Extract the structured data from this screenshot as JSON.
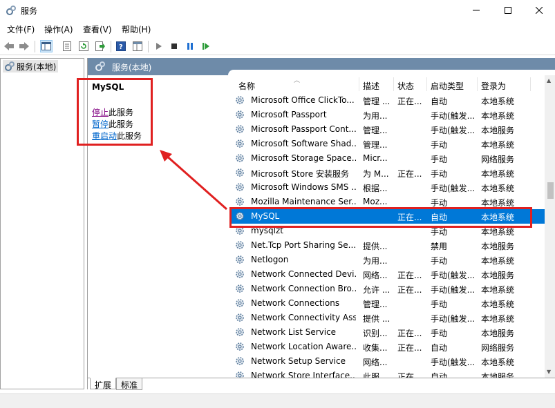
{
  "window": {
    "title": "服务"
  },
  "menu": [
    "文件(F)",
    "操作(A)",
    "查看(V)",
    "帮助(H)"
  ],
  "tree": {
    "item": "服务(本地)"
  },
  "panel": {
    "header": "服务(本地)"
  },
  "extended": {
    "service_name": "MySQL",
    "actions": [
      {
        "link": "停止",
        "rest": "此服务"
      },
      {
        "link": "暂停",
        "rest": "此服务"
      },
      {
        "link": "重启动",
        "rest": "此服务"
      }
    ]
  },
  "columns": [
    "名称",
    "描述",
    "状态",
    "启动类型",
    "登录为"
  ],
  "rows": [
    {
      "name": "Microsoft Office ClickTo...",
      "desc": "管理 ...",
      "status": "正在...",
      "startup": "自动",
      "logon": "本地系统"
    },
    {
      "name": "Microsoft Passport",
      "desc": "为用...",
      "status": "",
      "startup": "手动(触发...",
      "logon": "本地系统"
    },
    {
      "name": "Microsoft Passport Cont...",
      "desc": "管理...",
      "status": "",
      "startup": "手动(触发...",
      "logon": "本地服务"
    },
    {
      "name": "Microsoft Software Shad...",
      "desc": "管理...",
      "status": "",
      "startup": "手动",
      "logon": "本地系统"
    },
    {
      "name": "Microsoft Storage Space...",
      "desc": "Micr...",
      "status": "",
      "startup": "手动",
      "logon": "网络服务"
    },
    {
      "name": "Microsoft Store 安装服务",
      "desc": "为 M...",
      "status": "正在...",
      "startup": "手动",
      "logon": "本地系统"
    },
    {
      "name": "Microsoft Windows SMS ...",
      "desc": "根据...",
      "status": "",
      "startup": "手动(触发...",
      "logon": "本地系统"
    },
    {
      "name": "Mozilla Maintenance Ser...",
      "desc": "Moz...",
      "status": "",
      "startup": "手动",
      "logon": "本地系统"
    },
    {
      "name": "MySQL",
      "desc": "",
      "status": "正在...",
      "startup": "自动",
      "logon": "本地系统",
      "selected": true
    },
    {
      "name": "mysqlzt",
      "desc": "",
      "status": "",
      "startup": "手动",
      "logon": "本地系统"
    },
    {
      "name": "Net.Tcp Port Sharing Se...",
      "desc": "提供...",
      "status": "",
      "startup": "禁用",
      "logon": "本地服务"
    },
    {
      "name": "Netlogon",
      "desc": "为用...",
      "status": "",
      "startup": "手动",
      "logon": "本地系统"
    },
    {
      "name": "Network Connected Devi...",
      "desc": "网络...",
      "status": "正在...",
      "startup": "手动(触发...",
      "logon": "本地服务"
    },
    {
      "name": "Network Connection Bro...",
      "desc": "允许 ...",
      "status": "正在...",
      "startup": "手动(触发...",
      "logon": "本地系统"
    },
    {
      "name": "Network Connections",
      "desc": "管理...",
      "status": "",
      "startup": "手动",
      "logon": "本地系统"
    },
    {
      "name": "Network Connectivity Ass...",
      "desc": "提供 ...",
      "status": "",
      "startup": "手动(触发...",
      "logon": "本地系统"
    },
    {
      "name": "Network List Service",
      "desc": "识别...",
      "status": "正在...",
      "startup": "手动",
      "logon": "本地服务"
    },
    {
      "name": "Network Location Aware...",
      "desc": "收集...",
      "status": "正在...",
      "startup": "自动",
      "logon": "网络服务"
    },
    {
      "name": "Network Setup Service",
      "desc": "网络...",
      "status": "",
      "startup": "手动(触发...",
      "logon": "本地系统"
    },
    {
      "name": "Network Store Interface...",
      "desc": "此服...",
      "status": "正在...",
      "startup": "自动",
      "logon": "本地服务"
    }
  ],
  "tabs": [
    "扩展",
    "标准"
  ],
  "colors": {
    "selection": "#0078d7",
    "header": "#6e8ba9",
    "annotation": "#e02020"
  }
}
